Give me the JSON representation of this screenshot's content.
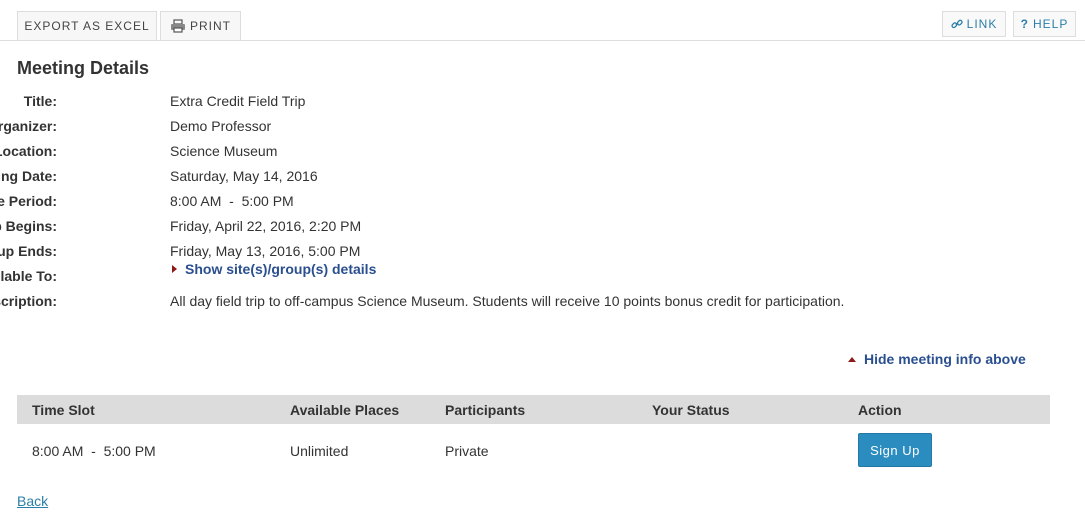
{
  "toolbar": {
    "export_label": "EXPORT AS EXCEL",
    "print_label": "PRINT",
    "link_label": "LINK",
    "help_label": "HELP"
  },
  "page_title": "Meeting Details",
  "details": [
    {
      "label": "Title:",
      "value": "Extra Credit Field Trip"
    },
    {
      "label": "Organizer:",
      "value": "Demo Professor"
    },
    {
      "label": "Location:",
      "value": "Science Museum"
    },
    {
      "label": "Meeting Date:",
      "value": "Saturday, May 14, 2016"
    },
    {
      "label": "Time Period:",
      "value": "8:00 AM  -  5:00 PM"
    },
    {
      "label": "Sign-up Begins:",
      "value": "Friday, April 22, 2016, 2:20 PM"
    },
    {
      "label": "Sign-up Ends:",
      "value": "Friday, May 13, 2016, 5:00 PM"
    },
    {
      "label": "Available To:",
      "value": ""
    },
    {
      "label": "Description:",
      "value": "All day field trip to off-campus Science Museum. Students will receive 10 points bonus credit for participation."
    }
  ],
  "show_groups_link": "Show site(s)/group(s) details",
  "hide_info_link": "Hide meeting info above",
  "table": {
    "headers": [
      "Time Slot",
      "Available Places",
      "Participants",
      "Your Status",
      "Action"
    ],
    "row": {
      "time_slot": "8:00 AM  -  5:00 PM",
      "available_places": "Unlimited",
      "participants": "Private",
      "your_status": "",
      "action_label": "Sign Up"
    }
  },
  "back_label": "Back",
  "colors": {
    "accent": "#2b8cbf",
    "link": "#2a4f8f",
    "header_bg": "#dcdcdc",
    "triangle": "#8b1a1a"
  }
}
